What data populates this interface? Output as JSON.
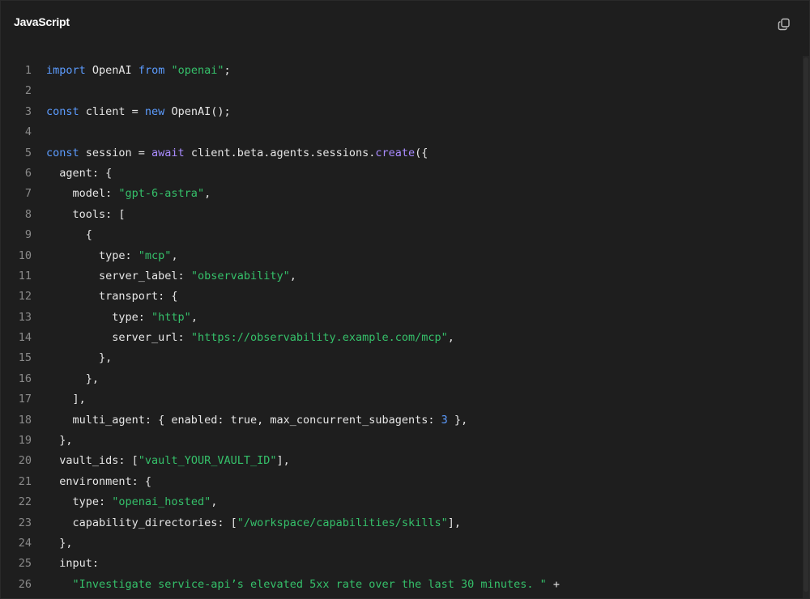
{
  "header": {
    "language": "JavaScript",
    "copy_icon": "copy-icon"
  },
  "code": {
    "lines": [
      [
        {
          "t": "import",
          "c": "kw"
        },
        {
          "t": " OpenAI "
        },
        {
          "t": "from",
          "c": "kw"
        },
        {
          "t": " "
        },
        {
          "t": "\"openai\"",
          "c": "str"
        },
        {
          "t": ";"
        }
      ],
      [],
      [
        {
          "t": "const",
          "c": "kw"
        },
        {
          "t": " client = "
        },
        {
          "t": "new",
          "c": "kw"
        },
        {
          "t": " OpenAI();"
        }
      ],
      [],
      [
        {
          "t": "const",
          "c": "kw"
        },
        {
          "t": " session = "
        },
        {
          "t": "await",
          "c": "fn"
        },
        {
          "t": " client.beta.agents.sessions."
        },
        {
          "t": "create",
          "c": "fn"
        },
        {
          "t": "({"
        }
      ],
      [
        {
          "t": "  agent: {"
        }
      ],
      [
        {
          "t": "    model: "
        },
        {
          "t": "\"gpt-6-astra\"",
          "c": "str"
        },
        {
          "t": ","
        }
      ],
      [
        {
          "t": "    tools: ["
        }
      ],
      [
        {
          "t": "      {"
        }
      ],
      [
        {
          "t": "        type: "
        },
        {
          "t": "\"mcp\"",
          "c": "str"
        },
        {
          "t": ","
        }
      ],
      [
        {
          "t": "        server_label: "
        },
        {
          "t": "\"observability\"",
          "c": "str"
        },
        {
          "t": ","
        }
      ],
      [
        {
          "t": "        transport: {"
        }
      ],
      [
        {
          "t": "          type: "
        },
        {
          "t": "\"http\"",
          "c": "str"
        },
        {
          "t": ","
        }
      ],
      [
        {
          "t": "          server_url: "
        },
        {
          "t": "\"https://observability.example.com/mcp\"",
          "c": "str"
        },
        {
          "t": ","
        }
      ],
      [
        {
          "t": "        },"
        }
      ],
      [
        {
          "t": "      },"
        }
      ],
      [
        {
          "t": "    ],"
        }
      ],
      [
        {
          "t": "    multi_agent: { enabled: true, max_concurrent_subagents: "
        },
        {
          "t": "3",
          "c": "num"
        },
        {
          "t": " },"
        }
      ],
      [
        {
          "t": "  },"
        }
      ],
      [
        {
          "t": "  vault_ids: ["
        },
        {
          "t": "\"vault_YOUR_VAULT_ID\"",
          "c": "str"
        },
        {
          "t": "],"
        }
      ],
      [
        {
          "t": "  environment: {"
        }
      ],
      [
        {
          "t": "    type: "
        },
        {
          "t": "\"openai_hosted\"",
          "c": "str"
        },
        {
          "t": ","
        }
      ],
      [
        {
          "t": "    capability_directories: ["
        },
        {
          "t": "\"/workspace/capabilities/skills\"",
          "c": "str"
        },
        {
          "t": "],"
        }
      ],
      [
        {
          "t": "  },"
        }
      ],
      [
        {
          "t": "  input:"
        }
      ],
      [
        {
          "t": "    "
        },
        {
          "t": "\"Investigate service-api’s elevated 5xx rate over the last 30 minutes. \"",
          "c": "str"
        },
        {
          "t": " +"
        }
      ]
    ]
  },
  "colors": {
    "background": "#1e1e1e",
    "keyword": "#5c9cff",
    "function": "#a98bff",
    "string": "#35c06a",
    "text": "#e6e6e6",
    "line_number": "#8a8a8a"
  }
}
